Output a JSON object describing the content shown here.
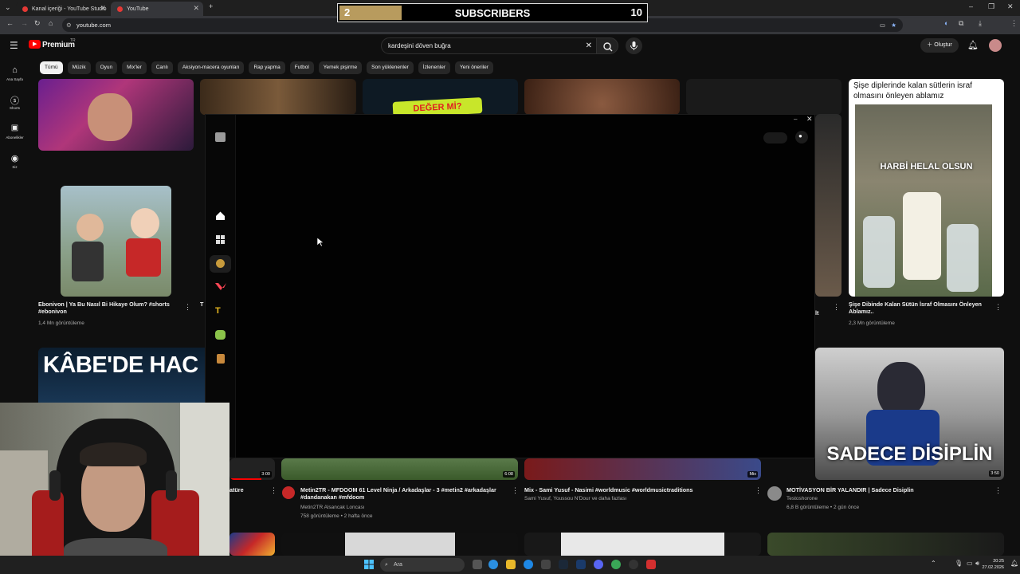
{
  "browser": {
    "tabs": [
      {
        "label": "Kanal içeriği - YouTube Studio"
      },
      {
        "label": "YouTube"
      }
    ],
    "url": "youtube.com"
  },
  "overlay": {
    "current": "2",
    "label": "SUBSCRIBERS",
    "goal": "10",
    "progress": 0.2
  },
  "youtube": {
    "logo": "Premium",
    "logo_sup": "TR",
    "search_value": "kardeşini döven buğra",
    "create_label": "Oluştur",
    "rail": [
      {
        "label": "Ana Sayfa"
      },
      {
        "label": "Shorts"
      },
      {
        "label": "Abonelikler"
      },
      {
        "label": "Siz"
      }
    ],
    "chips": [
      "Tümü",
      "Müzik",
      "Oyun",
      "Mix'ler",
      "Canlı",
      "Aksiyon-macera oyunları",
      "Rap yapma",
      "Futbol",
      "Yemek pişirme",
      "Son yüklenenler",
      "İzlenenler",
      "Yeni öneriler"
    ]
  },
  "videos": {
    "short1": {
      "title": "Ebonivon | Ya Bu Nasıl Bi Hikaye Olum? #shorts #ebonivon",
      "views": "1,4 Mn görüntüleme"
    },
    "short2": {
      "title": "Şişe Dibinde Kalan Sütün İsraf Olmasını Önleyen Ablamız..",
      "views": "2,3 Mn görüntüleme",
      "overlay_text": "Şişe diplerinde kalan sütlerin israf olmasını önleyen ablamız",
      "stamp": "HARBİ HELAL OLSUN"
    },
    "partial_title": "lt",
    "partial_left_title": "T",
    "thumb_text_kabe": "KÂBE'DE HAC",
    "thumb_text_deger": "DEĞER Mİ?",
    "v1": {
      "title": "Metin2TR - MFDOOM 61 Level Ninja / Arkadaşlar - 3 #metin2 #arkadaşlar #dandanakan #mfdoom",
      "channel": "Metin2TR Alsancak Loncası",
      "meta": "758 görüntüleme • 2 hafta önce",
      "duration": "6:08"
    },
    "v2": {
      "title": "Mix - Sami Yusuf - Nasimi #worldmusic #worldmusictraditions",
      "channel": "Sami Yusuf, Youssou N'Dour ve daha fazlası",
      "duration": "Mix"
    },
    "v3": {
      "title": "MOTİVASYON BİR YALANDIR | Sadece Disiplin",
      "channel": "Testoshorone",
      "meta": "6,8 B görüntüleme • 2 gün önce",
      "duration": "3:50",
      "thumb_text": "SADECE DİSİPLİN"
    },
    "v0": {
      "title": "atüre",
      "duration": "3:00"
    }
  },
  "taskbar": {
    "search_placeholder": "Ara",
    "time": "20:25",
    "date": "27.02.2026"
  },
  "colors": {
    "youtube_red": "#ff0000",
    "overlay_progress": "#b89b5e",
    "chip_active": "#f1f1f1"
  }
}
